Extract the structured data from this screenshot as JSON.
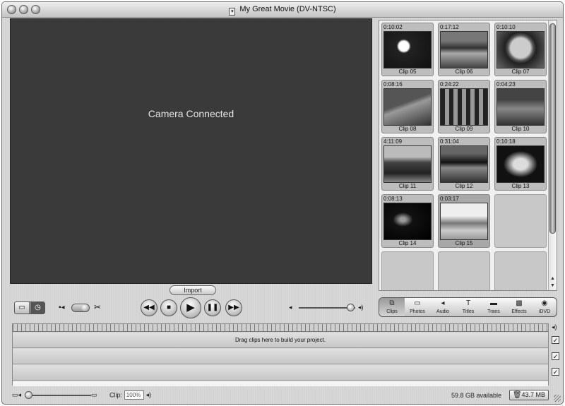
{
  "window": {
    "title": "My Great Movie (DV-NTSC)"
  },
  "monitor": {
    "message": "Camera Connected"
  },
  "import_button": {
    "label": "Import"
  },
  "clips": [
    {
      "time": "0:10:02",
      "name": "Clip 05"
    },
    {
      "time": "0:17:12",
      "name": "Clip 06"
    },
    {
      "time": "0:10:10",
      "name": "Clip 07"
    },
    {
      "time": "0:08:16",
      "name": "Clip 08"
    },
    {
      "time": "0:24:22",
      "name": "Clip 09"
    },
    {
      "time": "0:04:23",
      "name": "Clip 10"
    },
    {
      "time": "4:11:09",
      "name": "Clip 11"
    },
    {
      "time": "0:31:04",
      "name": "Clip 12"
    },
    {
      "time": "0:10:18",
      "name": "Clip 13"
    },
    {
      "time": "0:08:13",
      "name": "Clip 14"
    },
    {
      "time": "0:03:17",
      "name": "Clip 15"
    }
  ],
  "pane_buttons": [
    {
      "label": "Clips",
      "icon": "clips-icon"
    },
    {
      "label": "Photos",
      "icon": "photos-icon"
    },
    {
      "label": "Audio",
      "icon": "audio-icon"
    },
    {
      "label": "Titles",
      "icon": "titles-icon"
    },
    {
      "label": "Trans",
      "icon": "transitions-icon"
    },
    {
      "label": "Effects",
      "icon": "effects-icon"
    },
    {
      "label": "iDVD",
      "icon": "idvd-icon"
    }
  ],
  "timeline": {
    "hint": "Drag clips here to build your project."
  },
  "status": {
    "clip_label": "Clip:",
    "clip_volume": "100%",
    "disk_free": "59.8 GB available",
    "trash_size": "43.7 MB"
  },
  "colors": {
    "monitor_bg": "#3a3a3a",
    "shelf_bg": "#f0f0f0",
    "chrome": "#d6d6d6"
  }
}
